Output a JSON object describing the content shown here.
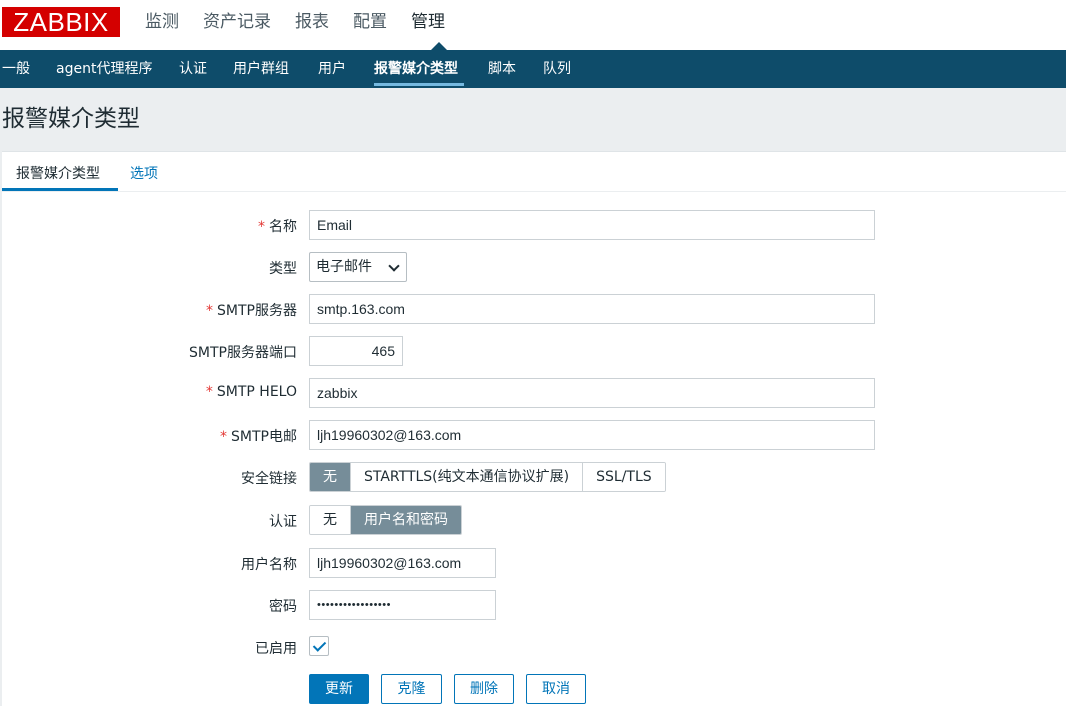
{
  "header": {
    "logo": "ZABBIX",
    "main_nav": [
      "监测",
      "资产记录",
      "报表",
      "配置",
      "管理"
    ],
    "active_main": "管理"
  },
  "subnav": {
    "items": [
      "一般",
      "agent代理程序",
      "认证",
      "用户群组",
      "用户",
      "报警媒介类型",
      "脚本",
      "队列"
    ],
    "active": "报警媒介类型"
  },
  "page": {
    "title": "报警媒介类型"
  },
  "tabs": {
    "media_type": "报警媒介类型",
    "options": "选项"
  },
  "form": {
    "name_label": "名称",
    "name_value": "Email",
    "type_label": "类型",
    "type_value": "电子邮件",
    "smtp_server_label": "SMTP服务器",
    "smtp_server_value": "smtp.163.com",
    "smtp_port_label": "SMTP服务器端口",
    "smtp_port_value": "465",
    "smtp_helo_label": "SMTP HELO",
    "smtp_helo_value": "zabbix",
    "smtp_email_label": "SMTP电邮",
    "smtp_email_value": "ljh19960302@163.com",
    "security_label": "安全链接",
    "security_options": [
      "无",
      "STARTTLS(纯文本通信协议扩展)",
      "SSL/TLS"
    ],
    "security_selected": "无",
    "auth_label": "认证",
    "auth_options": [
      "无",
      "用户名和密码"
    ],
    "auth_selected": "用户名和密码",
    "username_label": "用户名称",
    "username_value": "ljh19960302@163.com",
    "password_label": "密码",
    "password_value": "•••••••••••••••••",
    "enabled_label": "已启用",
    "enabled": true,
    "required_mark": "*"
  },
  "buttons": {
    "update": "更新",
    "clone": "克隆",
    "delete": "删除",
    "cancel": "取消"
  },
  "colors": {
    "brand": "#d40000",
    "nav_bg": "#0e4c6a",
    "accent": "#0275b8",
    "segment_selected": "#768d99",
    "required": "#e33734"
  }
}
